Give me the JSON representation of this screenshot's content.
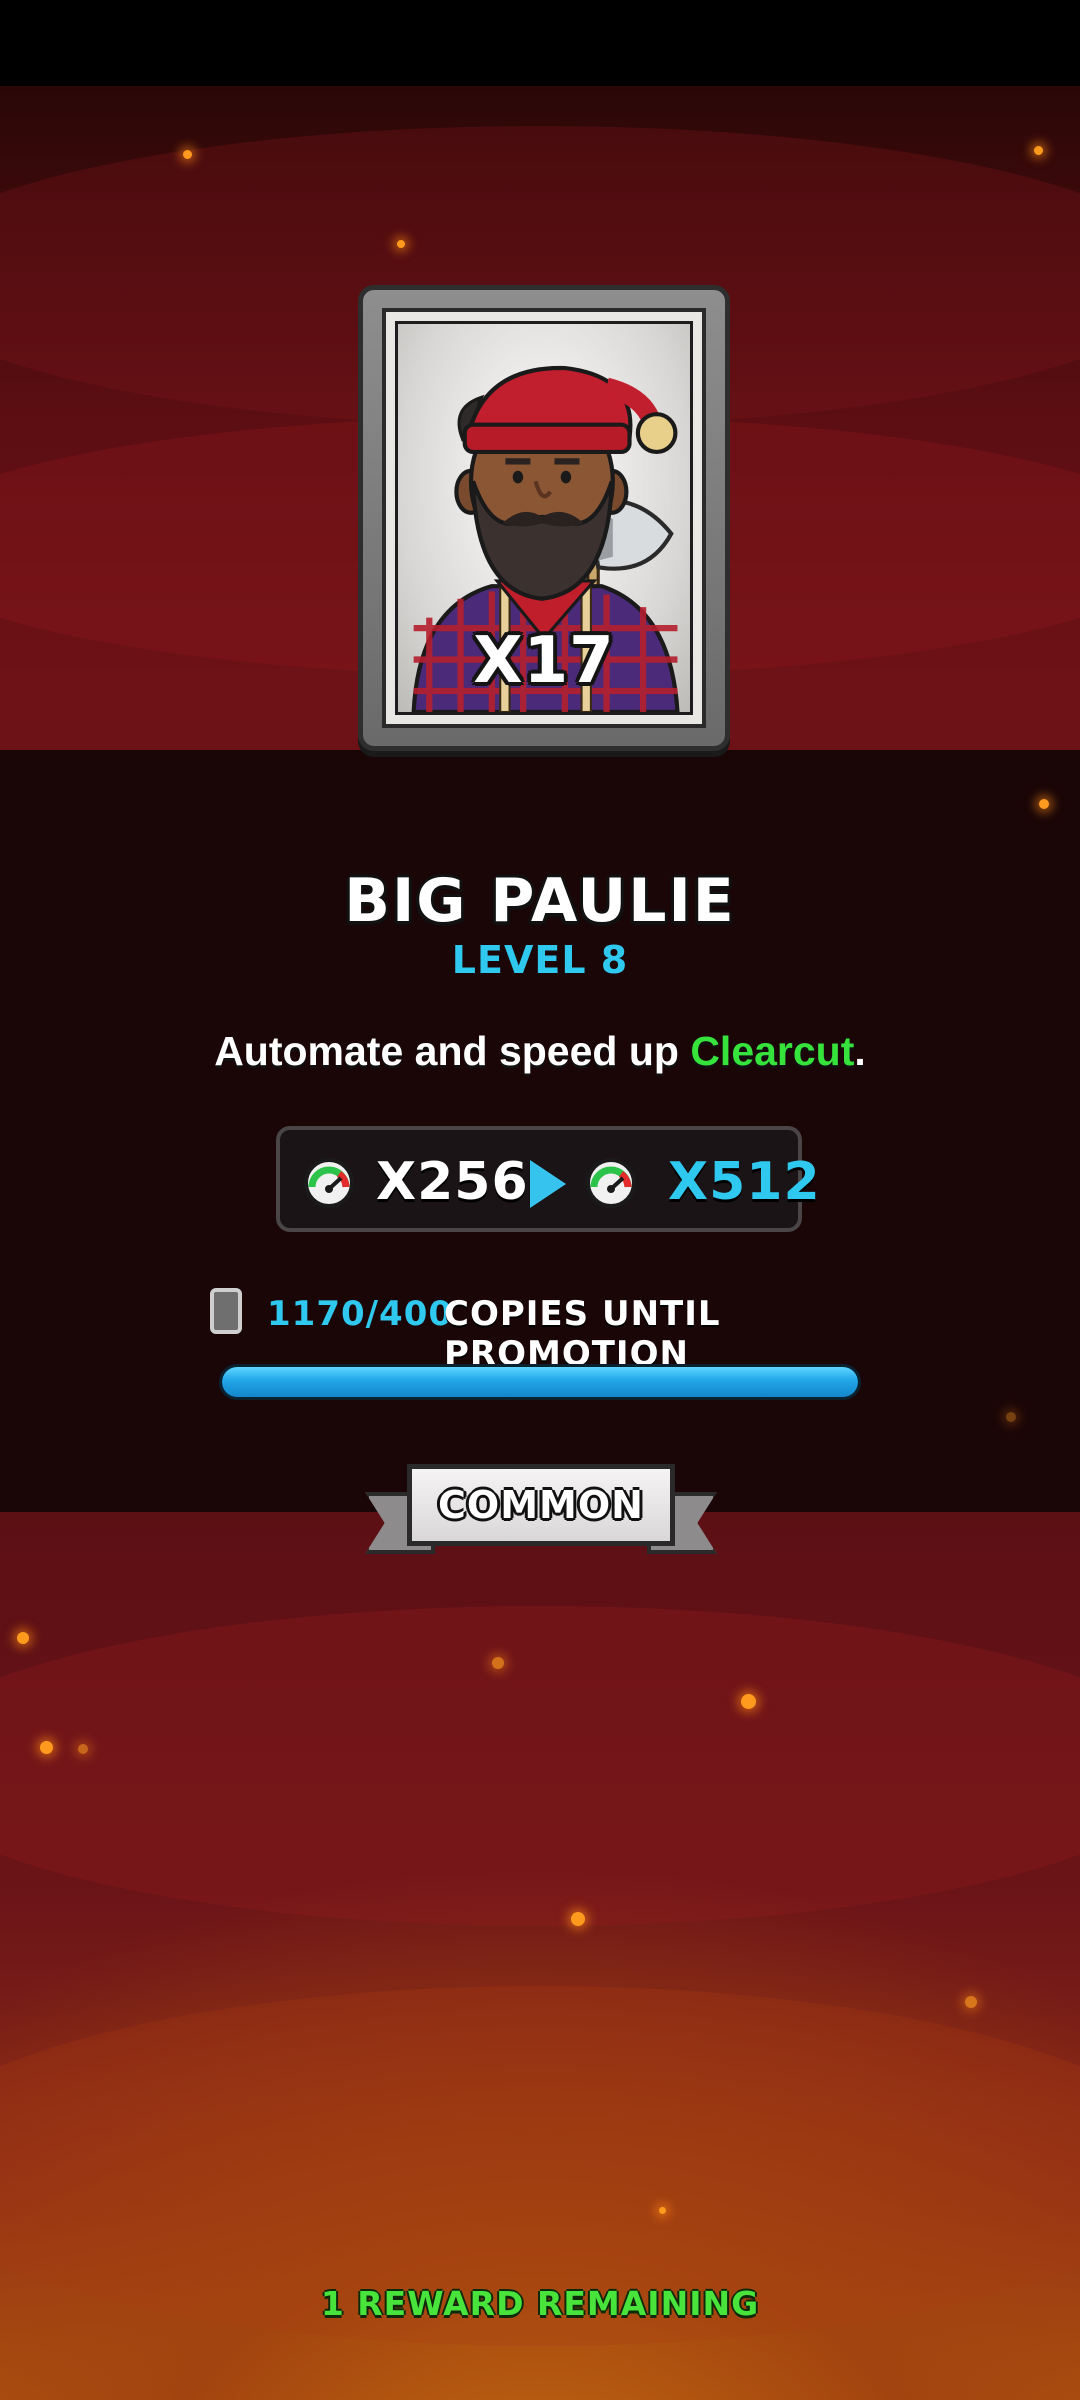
{
  "card": {
    "count": "X17",
    "name": "BIG PAULIE",
    "level": "LEVEL 8",
    "portrait_icon": "lumberjack-portrait"
  },
  "description": {
    "prefix": "Automate and speed up ",
    "highlight": "Clearcut",
    "suffix": "."
  },
  "multiplier": {
    "icon": "speed-gauge-icon",
    "current": "X256",
    "next": "X512"
  },
  "promotion": {
    "count": "1170/400",
    "label": "COPIES UNTIL PROMOTION",
    "progress_fraction": 1.0
  },
  "rarity": {
    "label": "COMMON"
  },
  "footer": {
    "rewards": "1 REWARD REMAINING"
  },
  "colors": {
    "accent_blue": "#2fc8ee",
    "highlight_green": "#36e23c",
    "background_red": "#6e1217"
  }
}
